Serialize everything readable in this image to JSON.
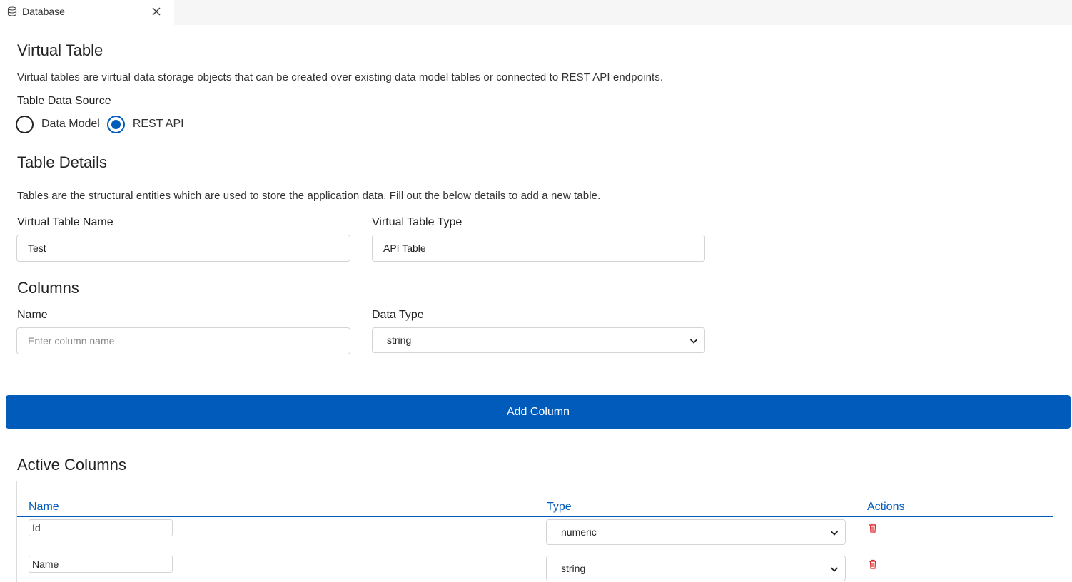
{
  "tab": {
    "label": "Database"
  },
  "virtual_table": {
    "title": "Virtual Table",
    "description": "Virtual tables are virtual data storage objects that can be created over existing data model tables or connected to REST API endpoints.",
    "source_label": "Table Data Source",
    "sources": [
      {
        "label": "Data Model",
        "checked": false
      },
      {
        "label": "REST API",
        "checked": true
      }
    ]
  },
  "table_details": {
    "title": "Table Details",
    "description": "Tables are the structural entities which are used to store the application data. Fill out the below details to add a new table.",
    "name_label": "Virtual Table Name",
    "name_value": "Test",
    "type_label": "Virtual Table Type",
    "type_value": "API Table"
  },
  "columns": {
    "title": "Columns",
    "name_label": "Name",
    "name_placeholder": "Enter column name",
    "type_label": "Data Type",
    "type_value": "string"
  },
  "add_button": {
    "label": "Add Column"
  },
  "active_columns": {
    "title": "Active Columns",
    "headers": {
      "name": "Name",
      "type": "Type",
      "actions": "Actions"
    },
    "rows": [
      {
        "name": "Id",
        "type": "numeric"
      },
      {
        "name": "Name",
        "type": "string"
      }
    ]
  },
  "colors": {
    "primary": "#005bbb",
    "delete": "#d9262c"
  },
  "icons": {
    "tab": "database-icon",
    "close": "close-icon",
    "dropdown": "chevron-down-icon",
    "delete": "trash-icon"
  }
}
